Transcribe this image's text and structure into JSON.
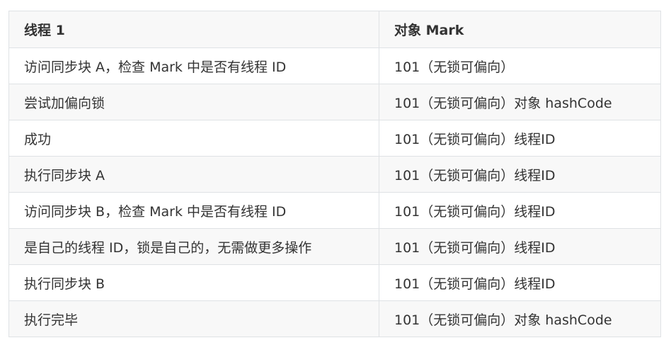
{
  "table": {
    "headers": [
      "线程 1",
      "对象 Mark"
    ],
    "rows": [
      [
        "访问同步块 A，检查 Mark 中是否有线程 ID",
        "101（无锁可偏向）"
      ],
      [
        "尝试加偏向锁",
        "101（无锁可偏向）对象 hashCode"
      ],
      [
        "成功",
        "101（无锁可偏向）线程ID"
      ],
      [
        "执行同步块 A",
        "101（无锁可偏向）线程ID"
      ],
      [
        "访问同步块 B，检查 Mark 中是否有线程 ID",
        "101（无锁可偏向）线程ID"
      ],
      [
        "是自己的线程 ID，锁是自己的，无需做更多操作",
        "101（无锁可偏向）线程ID"
      ],
      [
        "执行同步块 B",
        "101（无锁可偏向）线程ID"
      ],
      [
        "执行完毕",
        "101（无锁可偏向）对象 hashCode"
      ]
    ]
  }
}
